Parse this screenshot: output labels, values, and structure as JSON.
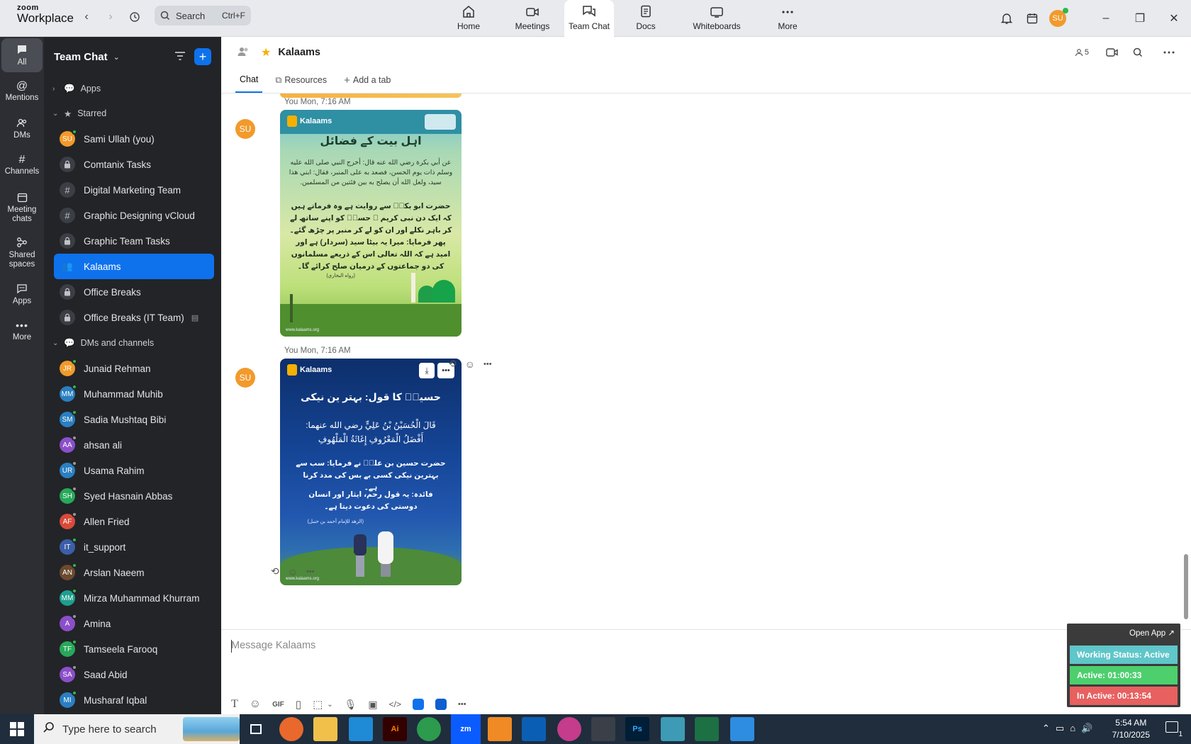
{
  "topbar": {
    "brand_top": "zoom",
    "brand_bottom": "Workplace",
    "search_label": "Search",
    "search_shortcut": "Ctrl+F",
    "tabs": [
      {
        "label": "Home"
      },
      {
        "label": "Meetings"
      },
      {
        "label": "Team Chat"
      },
      {
        "label": "Docs"
      },
      {
        "label": "Whiteboards"
      },
      {
        "label": "More"
      }
    ],
    "user_initials": "SU"
  },
  "rail": [
    {
      "label": "All"
    },
    {
      "label": "Mentions"
    },
    {
      "label": "DMs"
    },
    {
      "label": "Channels"
    },
    {
      "label": "Meeting chats"
    },
    {
      "label": "Shared spaces"
    },
    {
      "label": "Apps"
    },
    {
      "label": "More"
    }
  ],
  "sidebar": {
    "title": "Team Chat",
    "apps_label": "Apps",
    "starred_label": "Starred",
    "starred": [
      {
        "label": "Sami Ullah (you)",
        "initials": "SU",
        "color": "#f29a2b",
        "status": "#2db84d",
        "kind": "user"
      },
      {
        "label": "Comtanix Tasks",
        "kind": "lock"
      },
      {
        "label": "Digital Marketing Team",
        "kind": "hash"
      },
      {
        "label": "Graphic Designing vCloud",
        "kind": "hash"
      },
      {
        "label": "Graphic Team Tasks",
        "kind": "lock"
      },
      {
        "label": "Kalaams",
        "kind": "group",
        "active": true
      },
      {
        "label": "Office Breaks",
        "kind": "lock"
      },
      {
        "label": "Office Breaks (IT Team)",
        "kind": "lock"
      }
    ],
    "dms_label": "DMs and channels",
    "dms": [
      {
        "label": "Junaid Rehman",
        "initials": "JR",
        "color": "#f29a2b",
        "status": "#2db84d"
      },
      {
        "label": "Muhammad Muhib",
        "initials": "MM",
        "color": "#2a7fc1",
        "status": "#2db84d"
      },
      {
        "label": "Sadia Mushtaq Bibi",
        "initials": "SM",
        "color": "#2a7fc1",
        "status": "#2db84d"
      },
      {
        "label": "ahsan ali",
        "initials": "AA",
        "color": "#8b4fc9",
        "status": "#9a9a9a"
      },
      {
        "label": "Usama Rahim",
        "initials": "UR",
        "color": "#2a7fc1",
        "status": "#9a9a9a"
      },
      {
        "label": "Syed Hasnain Abbas",
        "initials": "SH",
        "color": "#27a85a",
        "status": "#9a9a9a"
      },
      {
        "label": "Allen Fried",
        "initials": "AF",
        "color": "#d84a3a",
        "status": "#9a9a9a"
      },
      {
        "label": "it_support",
        "initials": "IT",
        "color": "#3b5ea8",
        "status": "#2db84d"
      },
      {
        "label": "Arslan Naeem",
        "initials": "AN",
        "color": "#6b4a2f",
        "status": "#2db84d"
      },
      {
        "label": "Mirza Muhammad Khurram",
        "initials": "MM",
        "color": "#1e9e8e",
        "status": "#2db84d"
      },
      {
        "label": "Amina",
        "initials": "A",
        "color": "#8b4fc9",
        "status": "#9a9a9a"
      },
      {
        "label": "Tamseela Farooq",
        "initials": "TF",
        "color": "#27a85a",
        "status": "#2db84d"
      },
      {
        "label": "Saad Abid",
        "initials": "SA",
        "color": "#8b4fc9",
        "status": "#9a9a9a"
      },
      {
        "label": "Musharaf Iqbal",
        "initials": "MI",
        "color": "#2a7fc1",
        "status": "#2db84d"
      }
    ]
  },
  "channel": {
    "name": "Kalaams",
    "member_count": "5",
    "tabs": [
      {
        "label": "Chat"
      },
      {
        "label": "Resources"
      },
      {
        "label": "Add a tab"
      }
    ]
  },
  "messages": [
    {
      "initials": "SU",
      "sender": "You",
      "time": "Mon, 7:16 AM",
      "brand": "Kalaams",
      "heading": "اہل بیت کے فضائل",
      "arabic": "عن أبي بكرة رضي الله عنه قال: أخرج النبي صلى الله عليه وسلم ذات يوم الحسن، فصعد به على المنبر، فقال: ابني هذا سيد، ولعل الله أن يصلح به بين فئتين من المسلمين.",
      "urdu": "حضرت ابو بکرؓ سے روایت ہے وہ فرماتے ہیں کہ ایک دن نبی کریم ﷺ حسنؓ کو اپنے ساتھ لے کر باہر نکلے اور ان کو لے کر منبر پر چڑھ گئے۔ پھر فرمایا: میرا یہ بیٹا سید (سردار) ہے اور امید ہے کہ اللہ تعالی اس کے ذریعے مسلمانوں کی دو جماعتوں کے درمیان صلح کرائے گا۔",
      "source": "(رواه البخاري)",
      "site": "www.kalaams.org"
    },
    {
      "initials": "SU",
      "sender": "You",
      "time": "Mon, 7:16 AM",
      "brand": "Kalaams",
      "heading": "حسینؓ کا قول: بہتر ین نیکی",
      "arabic": "قَالَ الْحُسَيْنُ بْنُ عَلِيٍّ رضي الله عنهما: أَفْضَلُ الْمَعْرُوفِ إِغَاثَةُ الْمَلْهُوفِ",
      "urdu": "حضرت حسین بن علیؓ نے فرمایا: سب سے بہترین نیکی کسی بے بس کی مدد کرنا ہے۔",
      "note": "فائدہ: یہ قول رحم، ایثار اور انسان دوستی کی دعوت دیتا ہے۔",
      "source": "(الزهد للإمام أحمد بن حنبل)",
      "site": "www.kalaams.org"
    }
  ],
  "composer": {
    "placeholder": "Message Kalaams",
    "gif_label": "GIF"
  },
  "widget": {
    "open_label": "Open App ↗",
    "working": "Working Status: Active",
    "active": "Active: 01:00:33",
    "inactive": "In Active: 00:13:54"
  },
  "taskbar": {
    "search_placeholder": "Type here to search",
    "time": "5:54 AM",
    "date": "7/10/2025",
    "zoom_label": "zm",
    "notif_count": "1"
  },
  "colors": {
    "accent": "#0e72ed",
    "rail": "#2c2e33",
    "sidebar": "#222428",
    "active_green": "#4dcf6e",
    "inactive_red": "#e86060",
    "working_teal": "#5fc6c9"
  }
}
